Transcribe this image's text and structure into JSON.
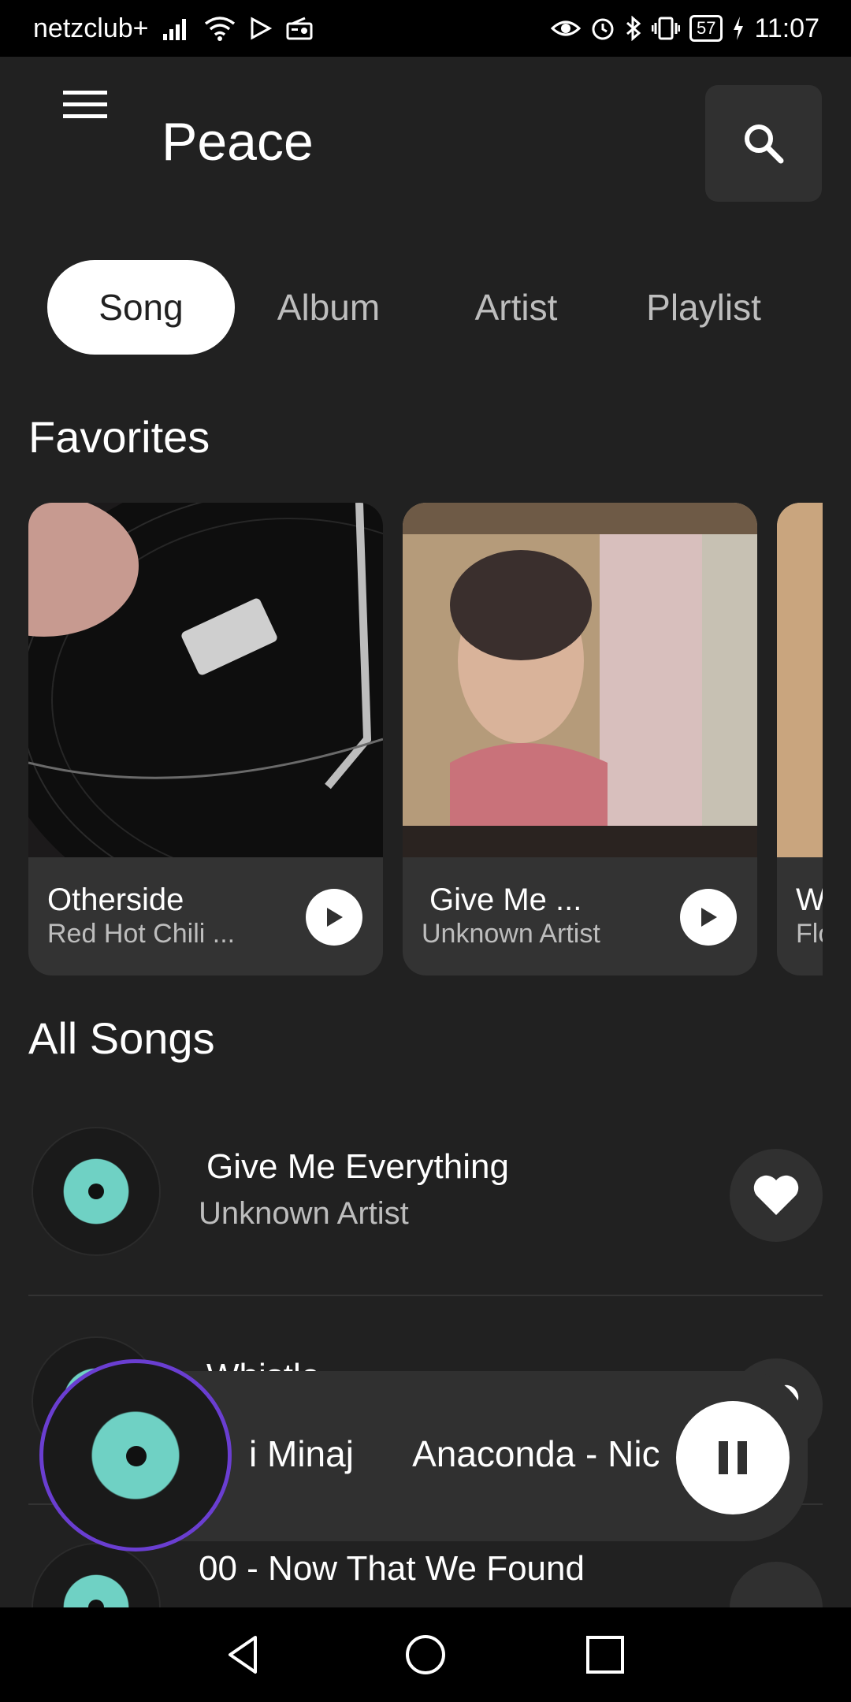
{
  "status_bar": {
    "carrier": "netzclub+",
    "battery": "57",
    "time": "11:07"
  },
  "header": {
    "title": "Peace"
  },
  "tabs": [
    {
      "label": "Song",
      "active": true
    },
    {
      "label": "Album",
      "active": false
    },
    {
      "label": "Artist",
      "active": false
    },
    {
      "label": "Playlist",
      "active": false
    }
  ],
  "favorites": {
    "title": "Favorites",
    "cards": [
      {
        "title": "Otherside",
        "artist": "Red Hot Chili ..."
      },
      {
        "title": "Give Me ...",
        "artist": "Unknown Artist"
      },
      {
        "title": "W",
        "artist": "Flo"
      }
    ]
  },
  "all_songs": {
    "title": "All Songs",
    "items": [
      {
        "title": "Give Me Everything",
        "artist": "Unknown Artist"
      },
      {
        "title": "Whistle",
        "artist": ""
      },
      {
        "title": "00 - Now That We Found",
        "artist": ""
      }
    ]
  },
  "mini_player": {
    "text": "i Minaj      Anaconda - Nic"
  },
  "colors": {
    "background": "#212121",
    "surface": "#303030",
    "accent_ring": "#6a3ed1",
    "disc_label": "#6fd1c4"
  },
  "icons": {
    "menu": "hamburger-icon",
    "search": "search-icon",
    "play": "play-icon",
    "heart": "heart-icon",
    "pause": "pause-icon",
    "back": "nav-back-icon",
    "home": "nav-home-icon",
    "recents": "nav-recents-icon"
  }
}
